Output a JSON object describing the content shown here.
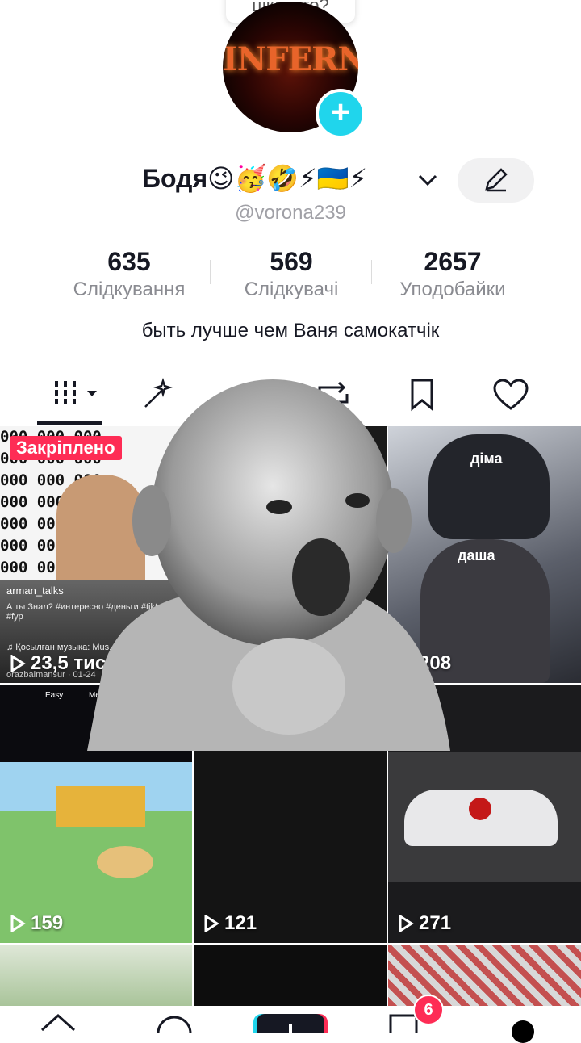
{
  "tooltip": {
    "text": "цікавого?"
  },
  "profile": {
    "avatar_text": "INFERNO",
    "display_name": "Бодя😉🥳🤣⚡🇺🇦⚡",
    "handle": "@vorona239",
    "bio": "быть лучше чем Ваня самокатчік"
  },
  "stats": [
    {
      "value": "635",
      "label": "Слідкування"
    },
    {
      "value": "569",
      "label": "Слідкувачі"
    },
    {
      "value": "2657",
      "label": "Уподобайки"
    }
  ],
  "tabs": [
    "videos-grid-icon",
    "magic-wand-icon",
    "repost-icon",
    "bookmark-icon",
    "heart-icon"
  ],
  "grid": [
    {
      "views": "23,5 тис",
      "pinned_label": "Закріплено",
      "caption_user": "arman_talks",
      "caption_text": "А ты Знал? #интересно #деньги #tiktok #fyp",
      "sound": "♫ Қосылған музыка: Mus...",
      "footer": "orazbaimansur · 01-24",
      "bg_text": "000 000 000"
    },
    {
      "views": "208",
      "label_1": "діма",
      "label_2": "даша"
    },
    {
      "views": "159"
    },
    {
      "views": "121"
    },
    {
      "views": "271"
    }
  ],
  "game_labels": {
    "easy": "Easy",
    "medium": "Me"
  },
  "nav": {
    "inbox_badge": "6"
  },
  "colors": {
    "accent_red": "#fe2c55",
    "accent_cyan": "#20d5ec"
  }
}
